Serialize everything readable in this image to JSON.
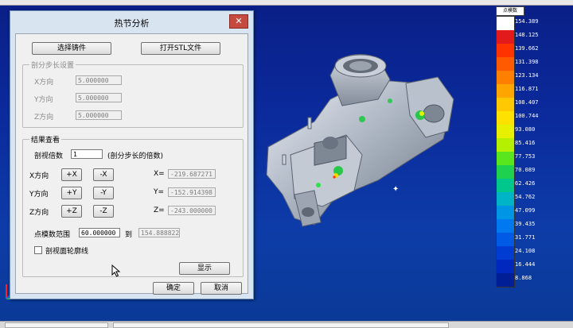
{
  "dialog": {
    "title": "热节分析",
    "close_glyph": "✕",
    "buttons": {
      "select_casting": "选择铸件",
      "open_stl": "打开STL文件",
      "display": "显示",
      "ok": "确定",
      "cancel": "取消"
    },
    "subdivision": {
      "label": "剖分步长设置",
      "rows": [
        {
          "label": "X方向",
          "value": "5.000000"
        },
        {
          "label": "Y方向",
          "value": "5.000000"
        },
        {
          "label": "Z方向",
          "value": "5.000000"
        }
      ]
    },
    "results": {
      "label": "结果查看",
      "section_multiplier_label": "剖视倍数",
      "section_multiplier_value": "1",
      "section_multiplier_hint": "(剖分步长的倍数)",
      "axes": [
        {
          "label": "X方向",
          "plus": "+X",
          "minus": "-X",
          "coord_label": "X=",
          "coord_value": "-219.687271"
        },
        {
          "label": "Y方向",
          "plus": "+Y",
          "minus": "-Y",
          "coord_label": "Y=",
          "coord_value": "-152.914398"
        },
        {
          "label": "Z方向",
          "plus": "+Z",
          "minus": "-Z",
          "coord_label": "Z=",
          "coord_value": "-243.000000"
        }
      ],
      "range_label": "点模数范围",
      "range_from": "60.000000",
      "range_to_label": "到",
      "range_to": "154.888822",
      "contour_checkbox_label": "剖视面轮廓线",
      "contour_checked": false
    }
  },
  "legend": {
    "title": "点模数",
    "values": [
      "154.389",
      "148.125",
      "139.662",
      "131.398",
      "123.134",
      "116.871",
      "108.407",
      "100.744",
      "93.080",
      "85.416",
      "77.753",
      "70.089",
      "62.426",
      "54.762",
      "47.099",
      "39.435",
      "31.771",
      "24.108",
      "16.444",
      "8.868"
    ],
    "colors": [
      "#ffffff",
      "#e31a1c",
      "#ff3300",
      "#ff5a00",
      "#ff7f00",
      "#ffa500",
      "#ffc800",
      "#ffe100",
      "#e6f000",
      "#b4f000",
      "#5ae61e",
      "#1ed250",
      "#00c88c",
      "#00b4c8",
      "#0096e6",
      "#0078f0",
      "#005ae6",
      "#003cd2",
      "#0028be",
      "#001e96"
    ]
  },
  "icons": {
    "cursor": "arrow-cursor-icon",
    "axis": "axis-triad-icon",
    "sparkle": "sparkle-icon"
  }
}
